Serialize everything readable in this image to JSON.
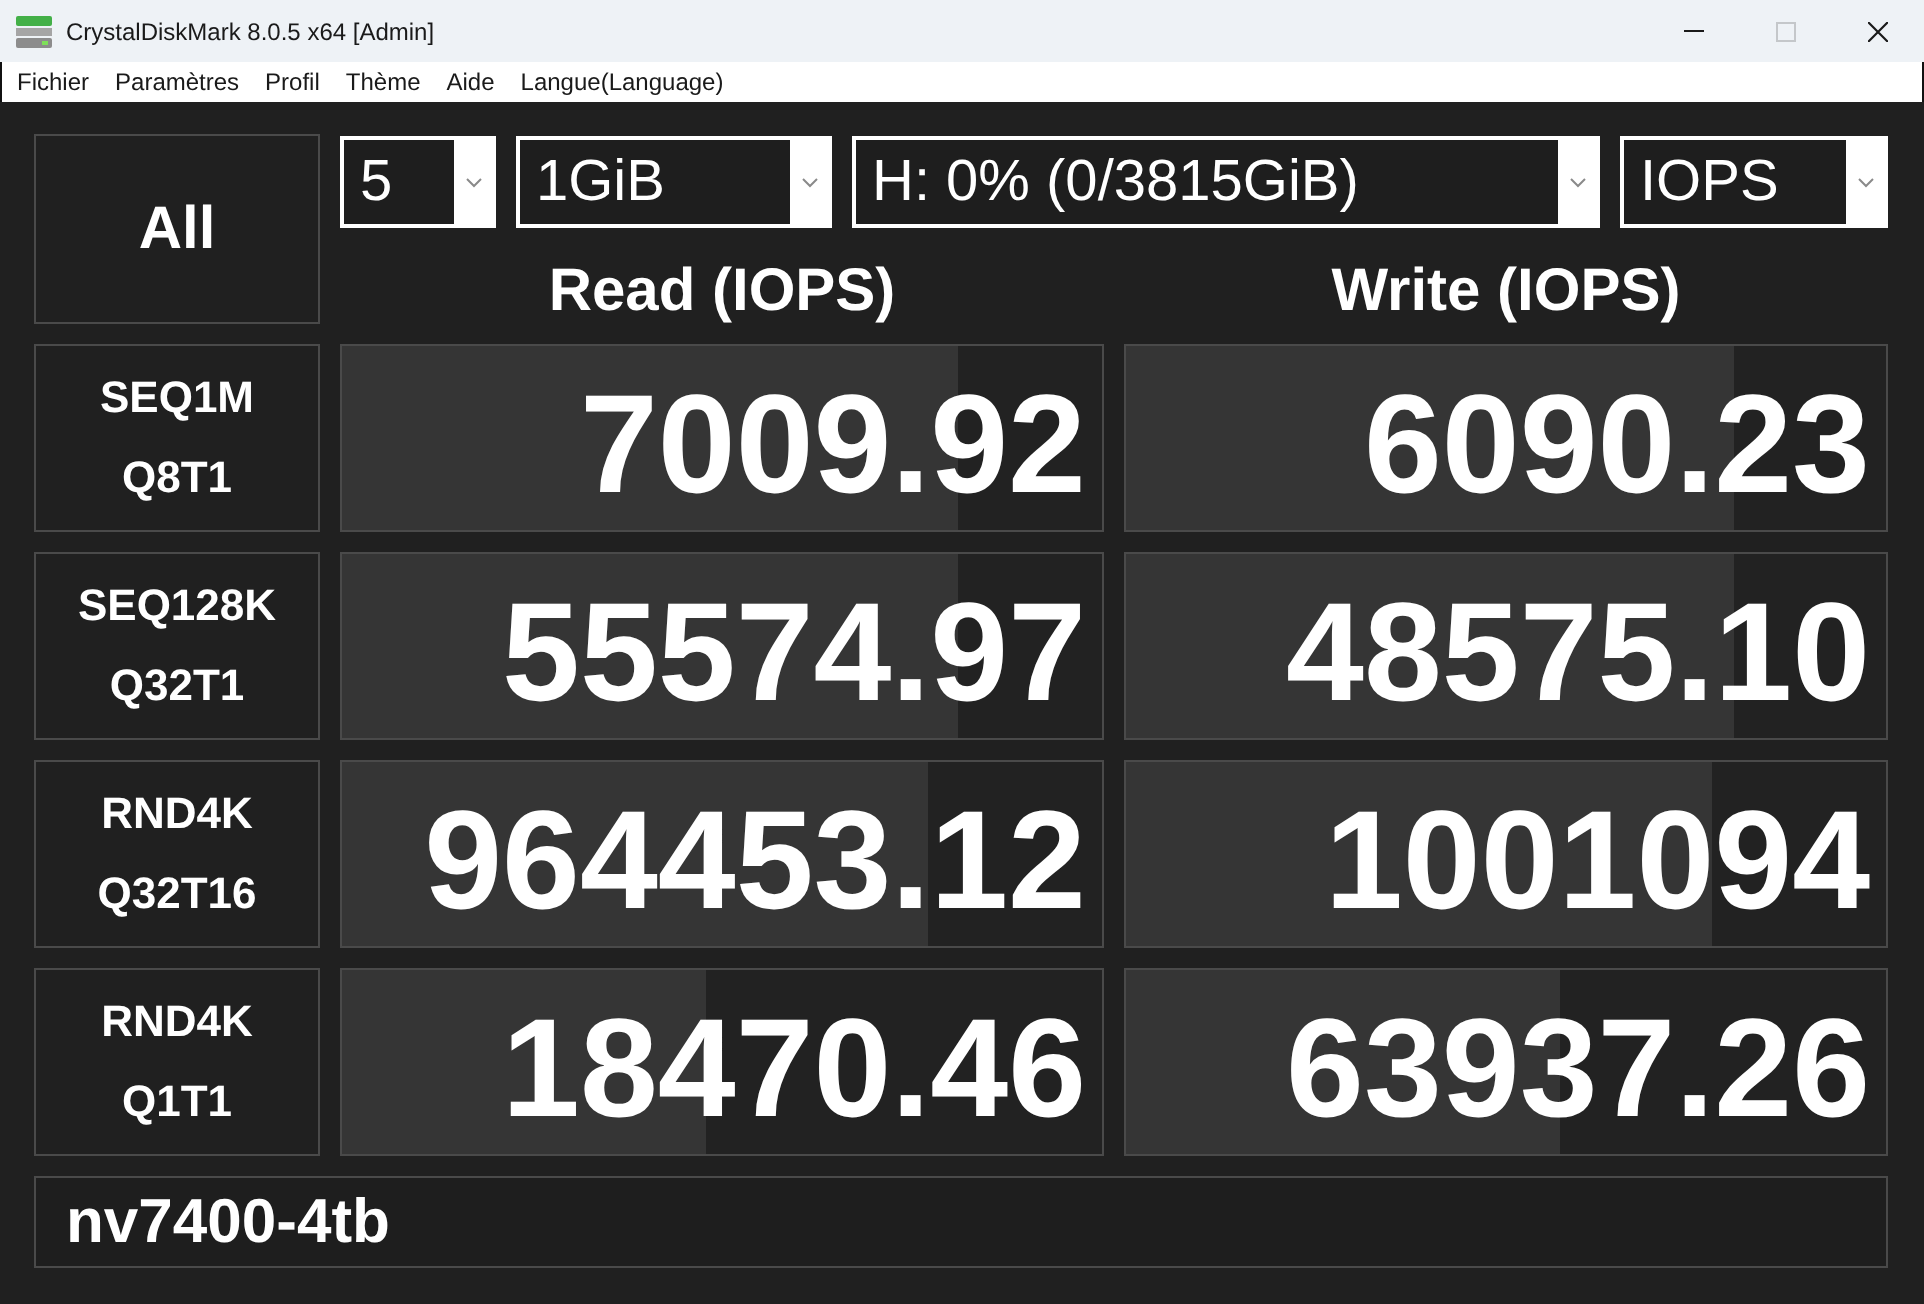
{
  "window": {
    "title": "CrystalDiskMark 8.0.5 x64 [Admin]",
    "controls": [
      {
        "kind": "minimize",
        "disabled": false
      },
      {
        "kind": "maximize",
        "disabled": true
      },
      {
        "kind": "close",
        "disabled": false
      }
    ]
  },
  "menu": [
    "Fichier",
    "Paramètres",
    "Profil",
    "Thème",
    "Aide",
    "Langue(Language)"
  ],
  "all_button": {
    "label": "All"
  },
  "settings": [
    {
      "value": "5"
    },
    {
      "value": "1GiB"
    },
    {
      "value": "H: 0% (0/3815GiB)"
    },
    {
      "value": "IOPS"
    }
  ],
  "columns": [
    {
      "header": "Read (IOPS)"
    },
    {
      "header": "Write (IOPS)"
    }
  ],
  "tests": [
    {
      "label": [
        "SEQ1M",
        "Q8T1"
      ],
      "read": {
        "value": "7009.92",
        "level": 0.81
      },
      "write": {
        "value": "6090.23",
        "level": 0.8
      }
    },
    {
      "label": [
        "SEQ128K",
        "Q32T1"
      ],
      "read": {
        "value": "55574.97",
        "level": 0.81
      },
      "write": {
        "value": "48575.10",
        "level": 0.8
      }
    },
    {
      "label": [
        "RND4K",
        "Q32T16"
      ],
      "read": {
        "value": "964453.12",
        "level": 0.77
      },
      "write": {
        "value": "1001094",
        "level": 0.77
      }
    },
    {
      "label": [
        "RND4K",
        "Q1T1"
      ],
      "read": {
        "value": "18470.46",
        "level": 0.48
      },
      "write": {
        "value": "63937.26",
        "level": 0.57
      }
    }
  ],
  "comment": "nv7400-4tb"
}
